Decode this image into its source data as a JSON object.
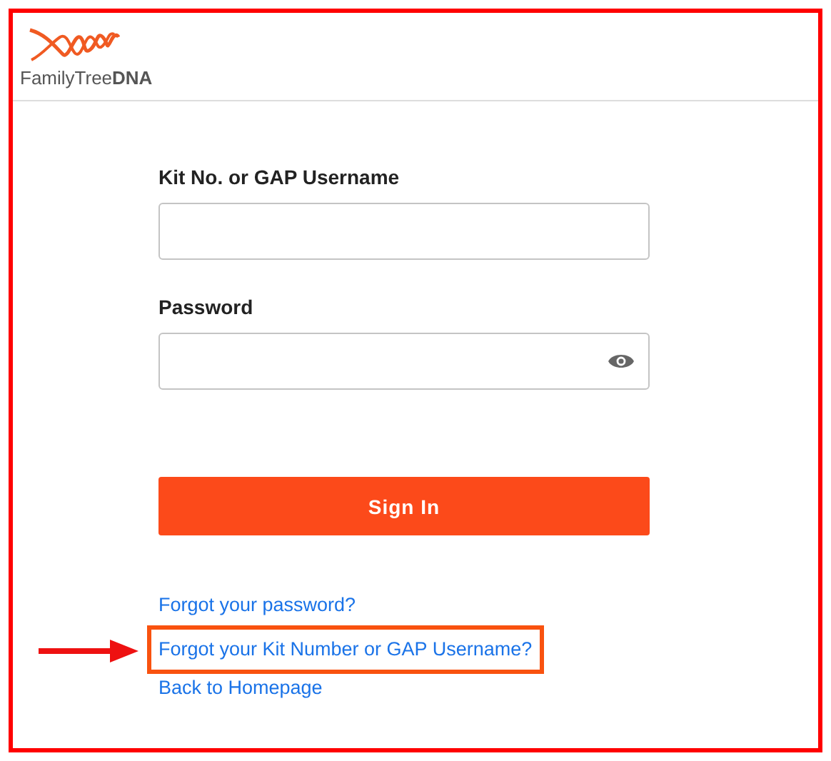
{
  "logo": {
    "text": "FamilyTree**DNA**"
  },
  "form": {
    "fields": [
      {
        "label": "Kit No. or GAP Username",
        "kind": "text"
      },
      {
        "label": "Password",
        "kind": "password"
      }
    ],
    "submit": "Sign In"
  },
  "links": [
    {
      "label": "Forgot your password?",
      "highlighted": false
    },
    {
      "label": "Forgot your Kit Number or GAP Username?",
      "highlighted": true
    },
    {
      "label": "Back to Homepage",
      "highlighted": false
    }
  ]
}
